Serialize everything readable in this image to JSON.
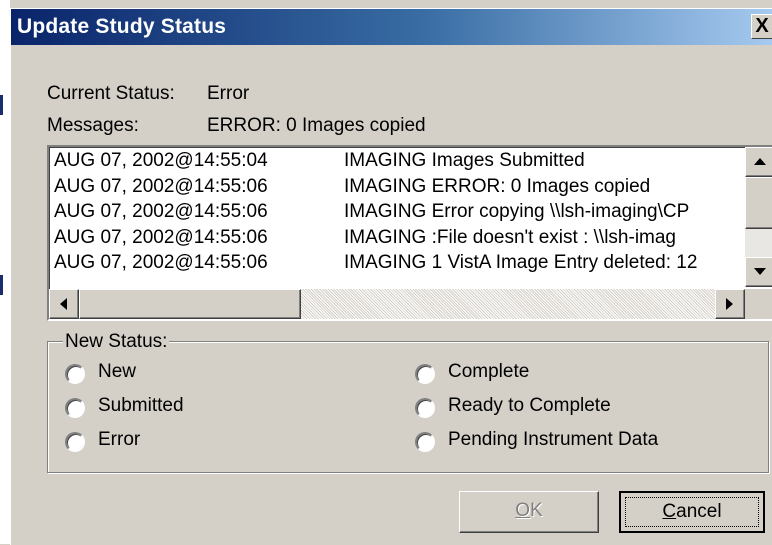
{
  "dialog": {
    "title": "Update Study Status",
    "close_label": "X"
  },
  "current_status": {
    "label": "Current Status:",
    "value": "Error"
  },
  "messages": {
    "label": "Messages:",
    "value": "ERROR: 0 Images copied"
  },
  "message_log": {
    "rows": [
      {
        "timestamp": "AUG 07, 2002@14:55:04",
        "text": "IMAGING Images Submitted"
      },
      {
        "timestamp": "AUG 07, 2002@14:55:06",
        "text": "IMAGING ERROR: 0 Images copied"
      },
      {
        "timestamp": "AUG 07, 2002@14:55:06",
        "text": "IMAGING Error copying \\\\lsh-imaging\\CP"
      },
      {
        "timestamp": "AUG 07, 2002@14:55:06",
        "text": "IMAGING    :File doesn't exist : \\\\lsh-imag"
      },
      {
        "timestamp": "AUG 07, 2002@14:55:06",
        "text": "IMAGING 1 VistA Image Entry deleted: 12"
      }
    ],
    "scroll_up_icon": "arrow-up-icon",
    "scroll_down_icon": "arrow-down-icon",
    "scroll_left_icon": "arrow-left-icon",
    "scroll_right_icon": "arrow-right-icon"
  },
  "new_status": {
    "title": "New Status:",
    "options": [
      "New",
      "Submitted",
      "Error",
      "Complete",
      "Ready to Complete",
      "Pending Instrument Data"
    ]
  },
  "buttons": {
    "ok_underlined": "O",
    "ok_rest": "K",
    "ok_enabled": false,
    "cancel_underlined": "C",
    "cancel_rest": "ancel"
  }
}
